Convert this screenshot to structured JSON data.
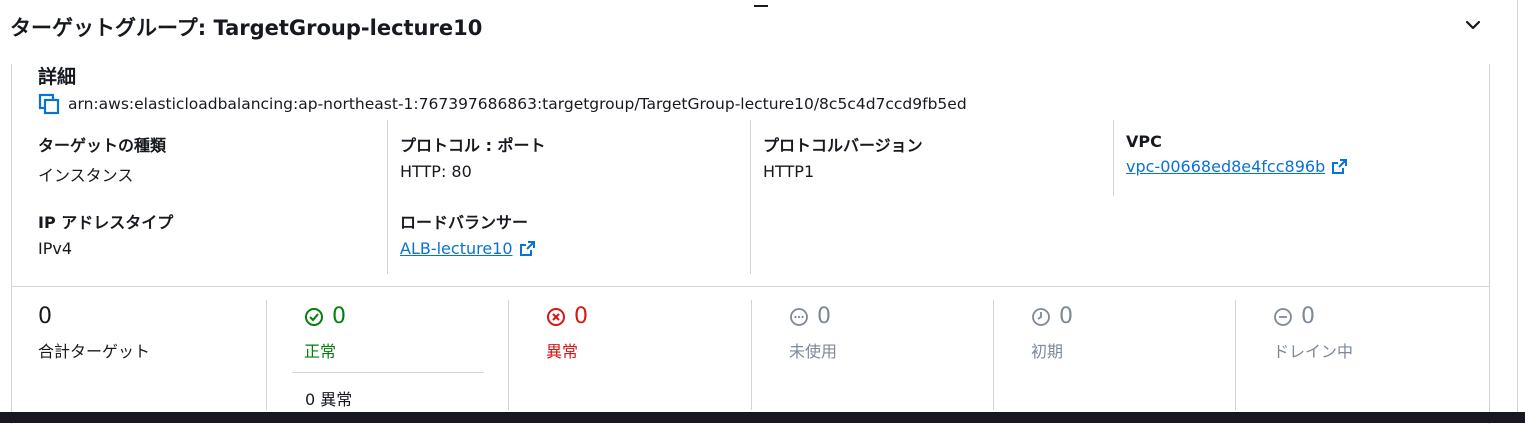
{
  "header": {
    "title": "ターゲットグループ: TargetGroup-lecture10"
  },
  "details": {
    "section_title": "詳細",
    "arn": "arn:aws:elasticloadbalancing:ap-northeast-1:767397686863:targetgroup/TargetGroup-lecture10/8c5c4d7ccd9fb5ed",
    "fields": {
      "target_type": {
        "label": "ターゲットの種類",
        "value": "インスタンス"
      },
      "protocol_port": {
        "label": "プロトコル : ポート",
        "value": "HTTP: 80"
      },
      "protocol_version": {
        "label": "プロトコルバージョン",
        "value": "HTTP1"
      },
      "vpc": {
        "label": "VPC",
        "value": "vpc-00668ed8e4fcc896b"
      },
      "ip_address_type": {
        "label": "IP アドレスタイプ",
        "value": "IPv4"
      },
      "load_balancer": {
        "label": "ロードバランサー",
        "value": "ALB-lecture10"
      }
    }
  },
  "stats": {
    "total": {
      "value": "0",
      "label": "合計ターゲット"
    },
    "healthy": {
      "value": "0",
      "label": "正常",
      "sub": "0 異常"
    },
    "unhealthy": {
      "value": "0",
      "label": "異常"
    },
    "unused": {
      "value": "0",
      "label": "未使用"
    },
    "initial": {
      "value": "0",
      "label": "初期"
    },
    "draining": {
      "value": "0",
      "label": "ドレイン中"
    }
  },
  "colors": {
    "link": "#0972d3",
    "healthy": "#037f0c",
    "unhealthy": "#d91515",
    "neutral": "#7d8998"
  },
  "icons": {
    "copy": "copy-icon",
    "external": "external-link-icon",
    "collapse": "chevron-down-icon",
    "healthy": "check-circle-icon",
    "unhealthy": "x-circle-icon",
    "unused": "dots-circle-icon",
    "initial": "clock-icon",
    "draining": "minus-circle-icon"
  }
}
